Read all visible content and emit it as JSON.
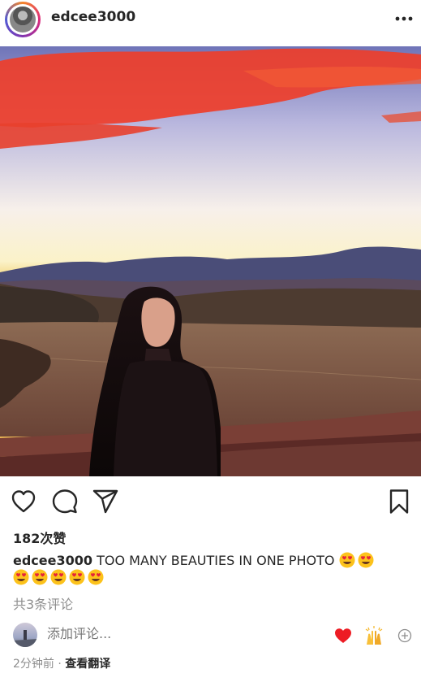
{
  "post": {
    "username": "edcee3000",
    "likes": "182次赞",
    "caption_text": "TOO MANY BEAUTIES IN ONE PHOTO",
    "caption_emojis": [
      "heart-eyes-emoji",
      "heart-eyes-emoji",
      "heart-eyes-emoji",
      "heart-eyes-emoji",
      "heart-eyes-emoji",
      "heart-eyes-emoji",
      "heart-eyes-emoji"
    ],
    "view_comments": "共3条评论",
    "timestamp": "2分钟前",
    "separator": "·",
    "translate": "查看翻译"
  },
  "comment_box": {
    "placeholder": "添加评论..."
  },
  "icons": {
    "more": "more-dots-icon",
    "like": "heart-outline-icon",
    "comment": "comment-bubble-icon",
    "share": "paper-plane-icon",
    "save": "bookmark-icon",
    "quick_heart": "red-heart-emoji",
    "quick_hands": "raised-hands-emoji",
    "add": "plus-circle-icon"
  },
  "colors": {
    "text": "#262626",
    "muted": "#8e8e8e",
    "heart_red": "#ed1c24"
  }
}
